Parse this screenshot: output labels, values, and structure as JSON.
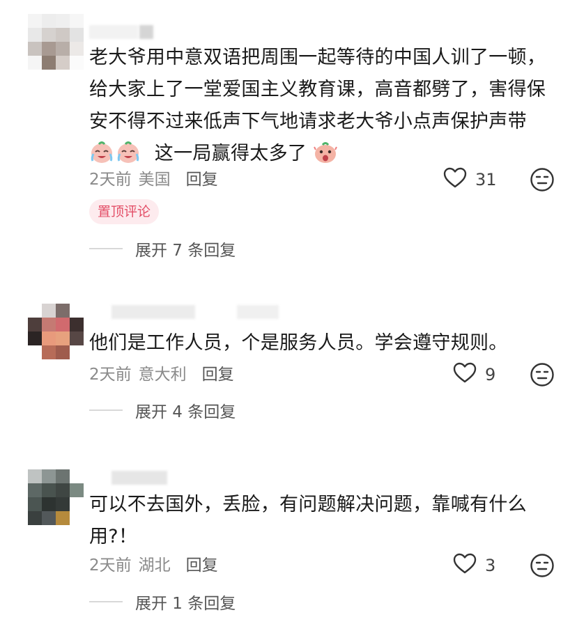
{
  "comments": [
    {
      "text_parts": [
        "老大爷用中意双语把周围一起等待的中国人训了一顿，给大家上了一堂爱国主义教育课，高音都劈了，害得保安不得不过来低声下气地请求老大爷小点声保护声带",
        "这一局赢得太多了"
      ],
      "time": "2天前",
      "location": "美国",
      "reply_label": "回复",
      "likes": "31",
      "pinned_label": "置顶评论",
      "expand_label": "展开 7 条回复"
    },
    {
      "text": "他们是工作人员，个是服务人员。学会遵守规则。",
      "time": "2天前",
      "location": "意大利",
      "reply_label": "回复",
      "likes": "9",
      "expand_label": "展开 4 条回复"
    },
    {
      "text": "可以不去国外，丢脸，有问题解决问题，靠喊有什么用?！",
      "time": "2天前",
      "location": "湖北",
      "reply_label": "回复",
      "likes": "3",
      "expand_label": "展开 1 条回复"
    }
  ],
  "icons": {
    "like": "heart-outline-icon",
    "react": "neutral-face-icon",
    "emoji_1": "crying-laughing-emoji",
    "emoji_2": "shocked-emoji"
  },
  "colors": {
    "pinned_badge_bg": "#fdebee",
    "pinned_badge_text": "#e34e67",
    "meta_text": "#8a8a8a"
  }
}
